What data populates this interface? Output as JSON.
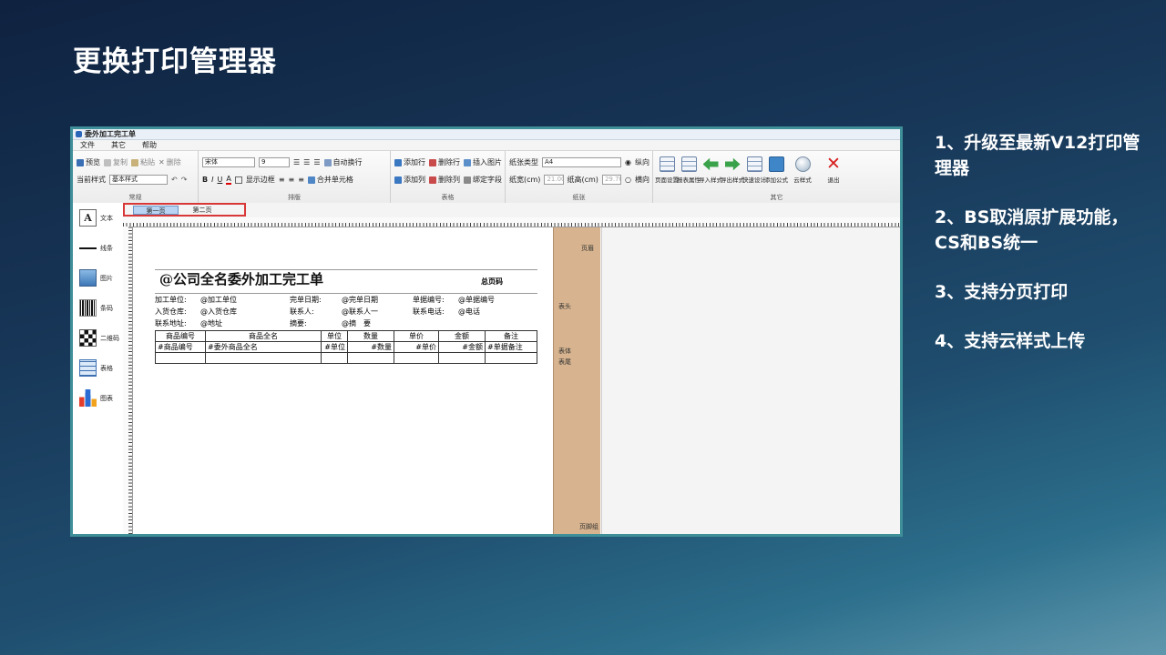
{
  "slide": {
    "title": "更换打印管理器"
  },
  "notes": [
    "1、升级至最新V12打印管理器",
    "2、BS取消原扩展功能，CS和BS统一",
    "3、支持分页打印",
    "4、支持云样式上传"
  ],
  "app": {
    "window_title": "委外加工完工单",
    "menu": [
      "文件",
      "其它",
      "帮助"
    ],
    "ribbon": {
      "general": {
        "label": "常规",
        "preview": "预览",
        "copy": "复制",
        "paste": "粘贴",
        "delete": "删除",
        "style_label": "当前样式",
        "style_value": "基本样式"
      },
      "layout": {
        "label": "排版",
        "font": "宋体",
        "size": "9",
        "bold": "B",
        "italic": "I",
        "underline": "U",
        "font_color": "A",
        "show_border": "显示边框",
        "auto_wrap": "自动换行",
        "merge_cells": "合并单元格"
      },
      "table": {
        "label": "表格",
        "add_row": "添加行",
        "del_row": "删除行",
        "insert_image": "插入图片",
        "add_col": "添加列",
        "del_col": "删除列",
        "bind_field": "绑定字段"
      },
      "paper": {
        "label": "纸张",
        "type_label": "纸张类型",
        "type_value": "A4",
        "portrait": "纵向",
        "landscape": "横向",
        "width_label": "纸宽(cm)",
        "width_value": "21.00",
        "height_label": "纸高(cm)",
        "height_value": "29.70"
      },
      "other": {
        "label": "其它",
        "buttons": [
          "页面设置",
          "报表属性",
          "导入样式",
          "导出样式",
          "快速设计",
          "添加公式",
          "云样式",
          "退出"
        ]
      }
    },
    "toolbox": [
      "文本",
      "线条",
      "图片",
      "条码",
      "二维码",
      "表格",
      "图表"
    ],
    "page_tabs": [
      "第一页",
      "第二页"
    ],
    "bands": {
      "page_header": "页眉",
      "table_header": "表头",
      "table_body": "表体",
      "table_footer": "表尾",
      "page_footer": "页脚组"
    },
    "report": {
      "title": "@公司全名委外加工完工单",
      "page_total": "总页码",
      "fields": [
        {
          "label": "加工单位:",
          "value": "@加工单位",
          "label2": "完单日期:",
          "value2": "@完单日期",
          "label3": "单据编号:",
          "value3": "@单据编号"
        },
        {
          "label": "入货仓库:",
          "value": "@入货仓库",
          "label2": "联系人:",
          "value2": "@联系人一",
          "label3": "联系电话:",
          "value3": "@电话"
        },
        {
          "label": "联系地址:",
          "value": "@地址",
          "label2": "摘要:",
          "value2": "@摘　要",
          "label3": "",
          "value3": ""
        }
      ],
      "columns": [
        "商品编号",
        "商品全名",
        "单位",
        "数量",
        "单价",
        "金额",
        "备注"
      ],
      "row": [
        "#商品编号",
        "#委外商品全名",
        "#单位",
        "#数量",
        "#单价",
        "#金额",
        "#单据备注"
      ]
    }
  }
}
